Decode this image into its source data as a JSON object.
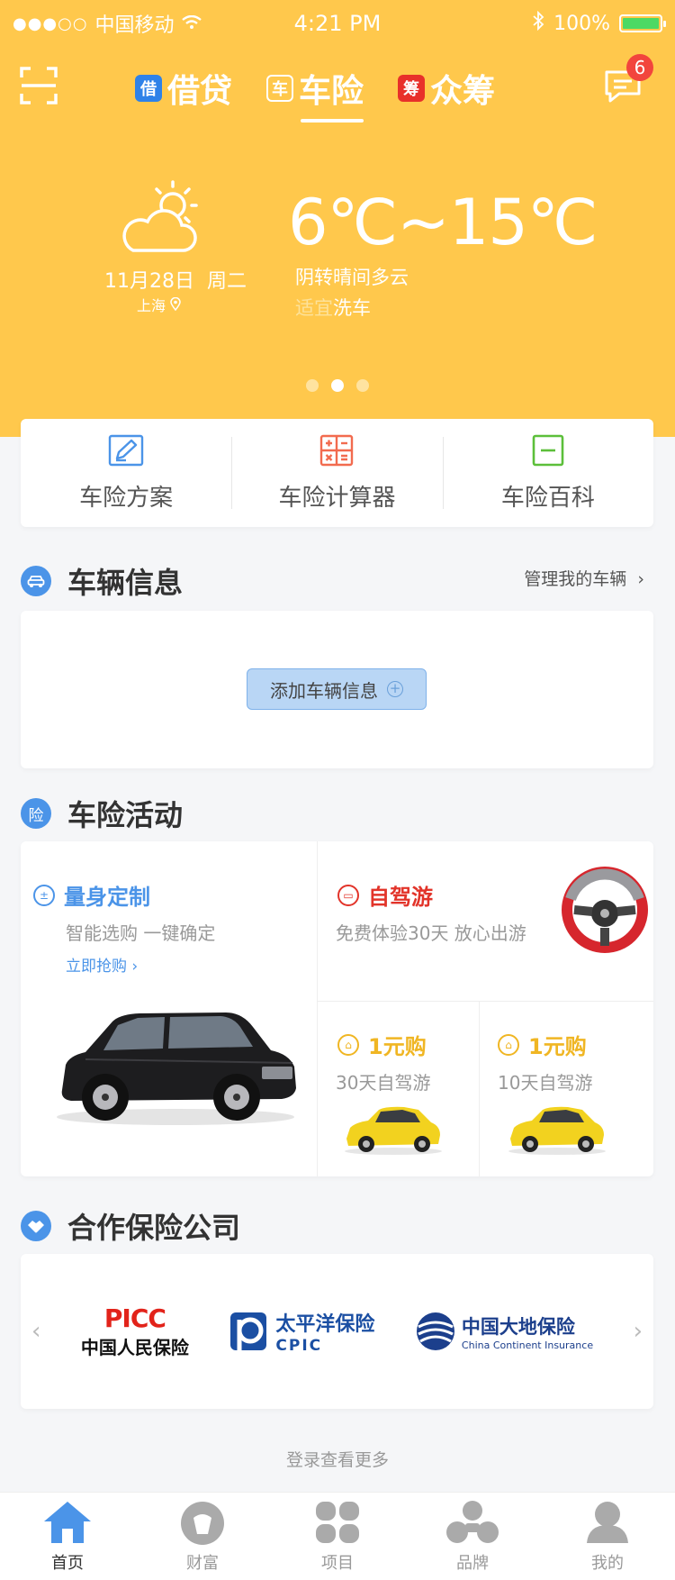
{
  "status_bar": {
    "dots": "●●●○○",
    "carrier": "中国移动",
    "time": "4:21 PM",
    "battery": "100%",
    "battery_level": 1.0
  },
  "header": {
    "tabs": [
      {
        "badge": "借",
        "label": "借贷",
        "badge_color": "#2f82e8",
        "active": false
      },
      {
        "badge": "车",
        "label": "车险",
        "badge_color": "#ffc84c",
        "active": true
      },
      {
        "badge": "筹",
        "label": "众筹",
        "badge_color": "#e8302a",
        "active": false
      }
    ],
    "message_count": "6"
  },
  "weather": {
    "date": "11月28日",
    "weekday": "周二",
    "city": "上海",
    "temperature": "6℃~15℃",
    "condition": "阴转晴间多云",
    "advice_prefix": "适宜",
    "advice_action": "洗车",
    "page_count": 3,
    "active_page": 2
  },
  "tools": [
    {
      "label": "车险方案",
      "icon": "edit-icon",
      "color": "#4b94e8"
    },
    {
      "label": "车险计算器",
      "icon": "calculator-icon",
      "color": "#f26b4f"
    },
    {
      "label": "车险百科",
      "icon": "book-icon",
      "color": "#5cbf3a"
    }
  ],
  "vehicle": {
    "title": "车辆信息",
    "icon": "car-icon",
    "manage_label": "管理我的车辆",
    "add_label": "添加车辆信息"
  },
  "activity": {
    "title": "车险活动",
    "icon_text": "险",
    "custom": {
      "title": "量身定制",
      "subtitle": "智能选购 一键确定",
      "link": "立即抢购"
    },
    "drive": {
      "title": "自驾游",
      "subtitle": "免费体验30天 放心出游"
    },
    "deals": [
      {
        "title": "1元购",
        "subtitle": "30天自驾游"
      },
      {
        "title": "1元购",
        "subtitle": "10天自驾游"
      }
    ],
    "colors": {
      "blue": "#4b94e8",
      "red": "#e2342a",
      "gold": "#f0b623"
    }
  },
  "partners": {
    "title": "合作保险公司",
    "logos": [
      {
        "brand": "PICC",
        "name": "中国人民保险"
      },
      {
        "brand": "太平洋保险",
        "name": "CPIC"
      },
      {
        "brand": "中国大地保险",
        "name": "China Continent Insurance"
      }
    ],
    "more": "登录查看更多"
  },
  "bottom_nav": [
    {
      "label": "首页",
      "icon": "home-icon",
      "active": true
    },
    {
      "label": "财富",
      "icon": "wealth-icon",
      "active": false
    },
    {
      "label": "项目",
      "icon": "project-icon",
      "active": false
    },
    {
      "label": "品牌",
      "icon": "brand-icon",
      "active": false
    },
    {
      "label": "我的",
      "icon": "profile-icon",
      "active": false
    }
  ]
}
